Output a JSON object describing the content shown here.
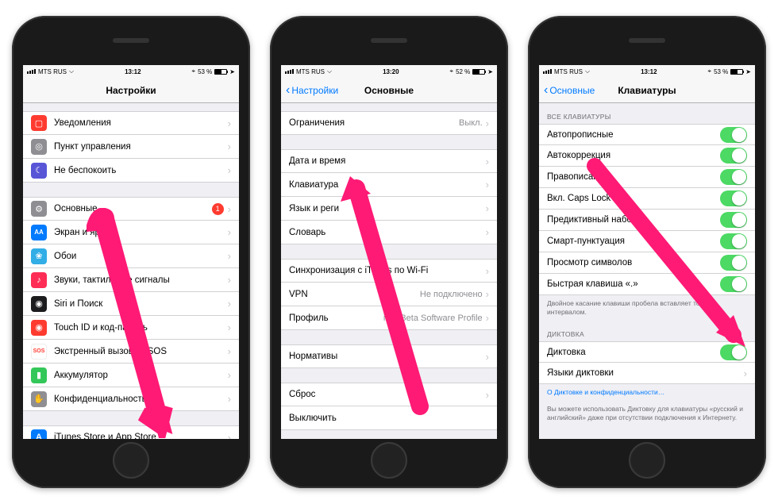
{
  "phones": [
    {
      "status": {
        "carrier": "MTS RUS",
        "wifi": "⏦",
        "time": "13:12",
        "bt": "✱",
        "pct": "53 %",
        "loc": "➤"
      },
      "nav": {
        "title": "Настройки",
        "back": null
      },
      "groups": [
        [
          {
            "icon": "notifications-icon",
            "cls": "ic-red",
            "glyph": "☐",
            "label": "Уведомления"
          },
          {
            "icon": "control-center-icon",
            "cls": "ic-grey",
            "glyph": "◉",
            "label": "Пункт управления"
          },
          {
            "icon": "dnd-icon",
            "cls": "ic-purple",
            "glyph": "☾",
            "label": "Не беспокоить"
          }
        ],
        [
          {
            "icon": "general-icon",
            "cls": "ic-grey",
            "glyph": "⚙",
            "label": "Основные",
            "badge": "1"
          },
          {
            "icon": "display-icon",
            "cls": "ic-blue",
            "glyph": "AA",
            "label": "Экран и яр"
          },
          {
            "icon": "wallpaper-icon",
            "cls": "ic-cyan",
            "glyph": "❀",
            "label": "Обои"
          },
          {
            "icon": "sounds-icon",
            "cls": "ic-pink",
            "glyph": "🔊",
            "label": "Звуки, тактильные сигналы"
          },
          {
            "icon": "siri-icon",
            "cls": "ic-black",
            "glyph": "◉",
            "label": "Siri и Поиск"
          },
          {
            "icon": "touchid-icon",
            "cls": "ic-red",
            "glyph": "◉",
            "label": "Touch ID и код-пароль"
          },
          {
            "icon": "sos-icon",
            "cls": "ic-orange",
            "glyph": "SOS",
            "label": "Экстренный вызов — SOS"
          },
          {
            "icon": "battery-icon",
            "cls": "ic-green",
            "glyph": "▮",
            "label": "Аккумулятор"
          },
          {
            "icon": "privacy-icon",
            "cls": "ic-grey",
            "glyph": "✋",
            "label": "Конфиденциальность"
          }
        ],
        [
          {
            "icon": "itunes-icon",
            "cls": "ic-blue",
            "glyph": "A",
            "label": "iTunes Store и App Store"
          }
        ]
      ]
    },
    {
      "status": {
        "carrier": "MTS RUS",
        "wifi": "⏦",
        "time": "13:20",
        "bt": "✱",
        "pct": "52 %",
        "loc": "➤"
      },
      "nav": {
        "title": "Основные",
        "back": "Настройки"
      },
      "groups": [
        [
          {
            "label": "Ограничения",
            "detail": "Выкл."
          }
        ],
        [
          {
            "label": "Дата и время"
          },
          {
            "label": "Клавиатура"
          },
          {
            "label": "Язык и реги"
          },
          {
            "label": "Словарь"
          }
        ],
        [
          {
            "label": "Синхронизация с iTunes по Wi-Fi"
          },
          {
            "label": "VPN",
            "detail": "Не подключено"
          },
          {
            "label": "Профиль",
            "detail": "iOS Beta Software Profile"
          }
        ],
        [
          {
            "label": "Нормативы"
          }
        ],
        [
          {
            "label": "Сброс"
          },
          {
            "label": "Выключить",
            "nochev": true
          }
        ]
      ]
    },
    {
      "status": {
        "carrier": "MTS RUS",
        "wifi": "⏦",
        "time": "13:12",
        "bt": "✱",
        "pct": "53 %",
        "loc": "➤"
      },
      "nav": {
        "title": "Клавиатуры",
        "back": "Основные"
      },
      "sections": [
        {
          "header": "ВСЕ КЛАВИАТУРЫ",
          "rows": [
            {
              "label": "Автопрописные",
              "toggle": true
            },
            {
              "label": "Автокоррекция",
              "toggle": true
            },
            {
              "label": "Правописание",
              "toggle": true
            },
            {
              "label": "Вкл. Caps Lock",
              "toggle": true
            },
            {
              "label": "Предиктивный набор",
              "toggle": true
            },
            {
              "label": "Смарт-пунктуация",
              "toggle": true
            },
            {
              "label": "Просмотр символов",
              "toggle": true
            },
            {
              "label": "Быстрая клавиша «.»",
              "toggle": true
            }
          ],
          "footer": "Двойное касание клавиши пробела вставляет точку с интервалом."
        },
        {
          "header": "ДИКТОВКА",
          "rows": [
            {
              "label": "Диктовка",
              "toggle": true
            },
            {
              "label": "Языки диктовки",
              "chev": true
            }
          ],
          "link": "О Диктовке и конфиденциальности…",
          "footer": "Вы можете использовать Диктовку для клавиатуры «русский и английский» даже при отсутствии подключения к Интернету."
        }
      ]
    }
  ]
}
